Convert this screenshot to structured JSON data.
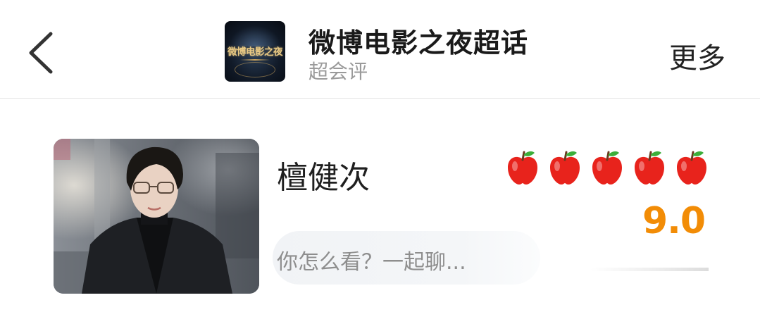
{
  "header": {
    "back_icon": "chevron-left-icon",
    "logo_text": "微博电影之夜",
    "title": "微博电影之夜超话",
    "subtitle": "超会评",
    "more_label": "更多"
  },
  "card": {
    "actor_name": "檀健次",
    "rating": {
      "icon": "apple-icon",
      "filled": 5,
      "max": 5
    },
    "score": "9.0",
    "comment_placeholder": "你怎么看？一起聊..."
  },
  "colors": {
    "score": "#f28c06",
    "apple": "#e8231c",
    "title": "#1a1a1a",
    "subtitle": "#9a9a9a"
  }
}
